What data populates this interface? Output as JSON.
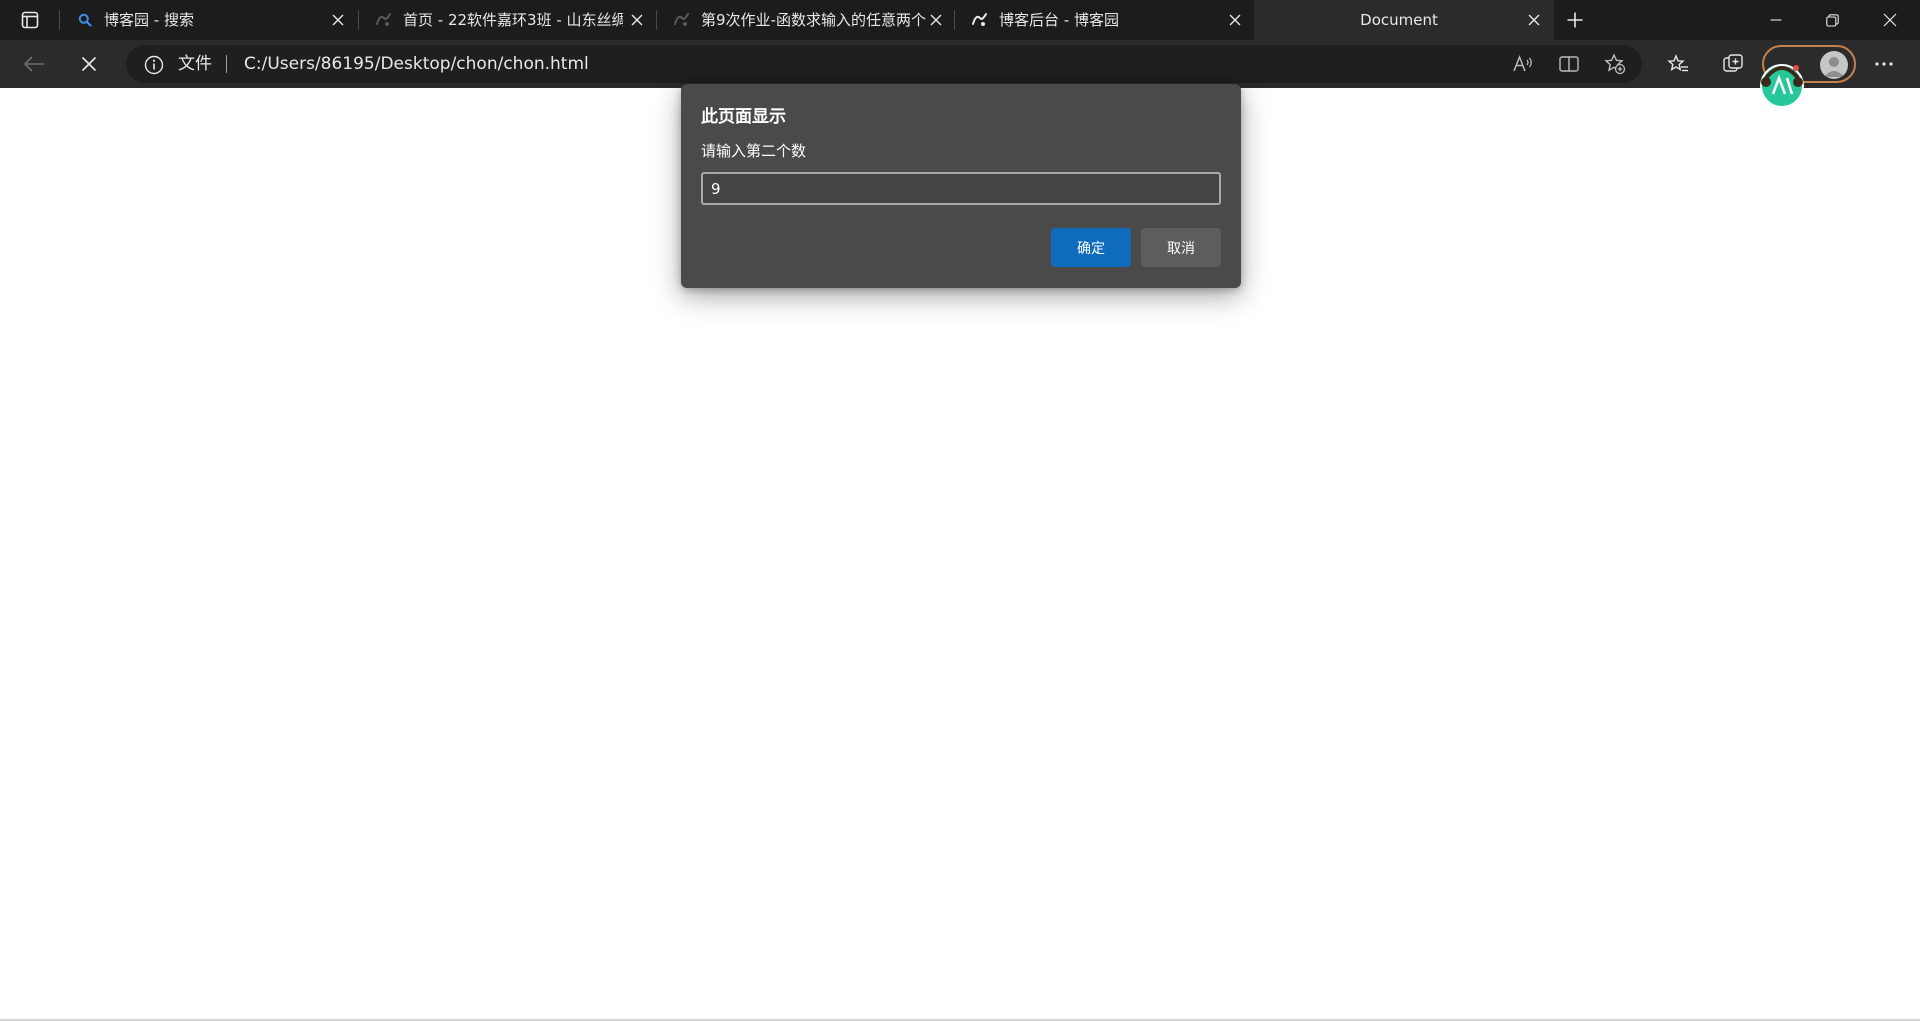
{
  "browser": {
    "tabs": [
      {
        "title": "博客园 - 搜索",
        "favicon": "search-icon"
      },
      {
        "title": "首页 - 22软件嘉环3班 - 山东丝绸",
        "favicon": "cnblogs-icon"
      },
      {
        "title": "第9次作业-函数求输入的任意两个",
        "favicon": "cnblogs-icon"
      },
      {
        "title": "博客后台 - 博客园",
        "favicon": "cnblogs-icon"
      },
      {
        "title": "Document",
        "favicon": ""
      }
    ],
    "active_tab_index": 4
  },
  "address_bar": {
    "scheme_label": "文件",
    "url": "C:/Users/86195/Desktop/chon/chon.html"
  },
  "dialog": {
    "title": "此页面显示",
    "message": "请输入第二个数",
    "input_value": "9",
    "ok_label": "确定",
    "cancel_label": "取消"
  },
  "colors": {
    "tabstrip_bg": "#1c1c1c",
    "toolbar_bg": "#2b2b2b",
    "dialog_bg": "#4a4a4a",
    "accent": "#0f6cbd"
  }
}
